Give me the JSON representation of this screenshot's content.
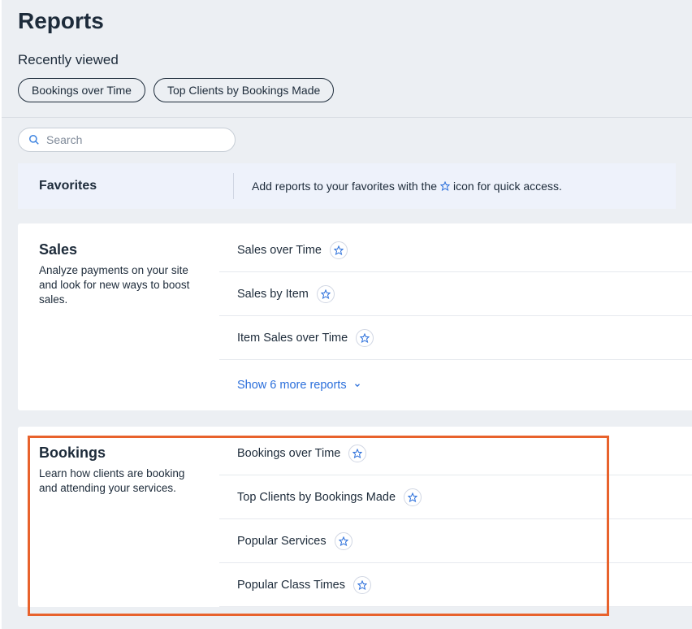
{
  "page": {
    "title": "Reports"
  },
  "recently": {
    "heading": "Recently viewed",
    "items": [
      {
        "label": "Bookings over Time"
      },
      {
        "label": "Top Clients by Bookings Made"
      }
    ]
  },
  "search": {
    "placeholder": "Search"
  },
  "favorites": {
    "title": "Favorites",
    "hint_before": "Add reports to your favorites with the",
    "hint_after": "icon for quick access."
  },
  "sections": {
    "sales": {
      "title": "Sales",
      "desc": "Analyze payments on your site and look for new ways to boost sales.",
      "reports": [
        {
          "name": "Sales over Time"
        },
        {
          "name": "Sales by Item"
        },
        {
          "name": "Item Sales over Time"
        }
      ],
      "show_more": "Show 6 more reports"
    },
    "bookings": {
      "title": "Bookings",
      "desc": "Learn how clients are booking and attending your services.",
      "reports": [
        {
          "name": "Bookings over Time"
        },
        {
          "name": "Top Clients by Bookings Made"
        },
        {
          "name": "Popular Services"
        },
        {
          "name": "Popular Class Times"
        }
      ]
    }
  }
}
